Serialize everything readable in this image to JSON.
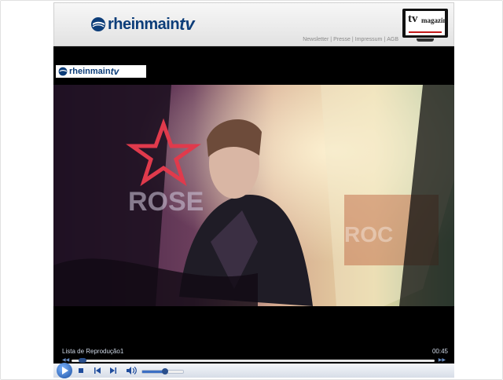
{
  "site": {
    "logo_text": "rheinmain",
    "logo_suffix": "tv",
    "nav": [
      "Newsletter",
      "Presse",
      "Impressum",
      "AGB"
    ],
    "tv_badge": {
      "main": "tv",
      "sub": "magazin"
    }
  },
  "video": {
    "watermark_text": "rheinmain",
    "watermark_suffix": "tv"
  },
  "controls": {
    "playlist_label": "Lista de Reprodução1",
    "time": "00:45",
    "seek_position": 0.03,
    "volume_level": 0.55
  },
  "colors": {
    "brand": "#0c3d79",
    "player_bg": "#000000",
    "accent": "#1f4c9c"
  }
}
